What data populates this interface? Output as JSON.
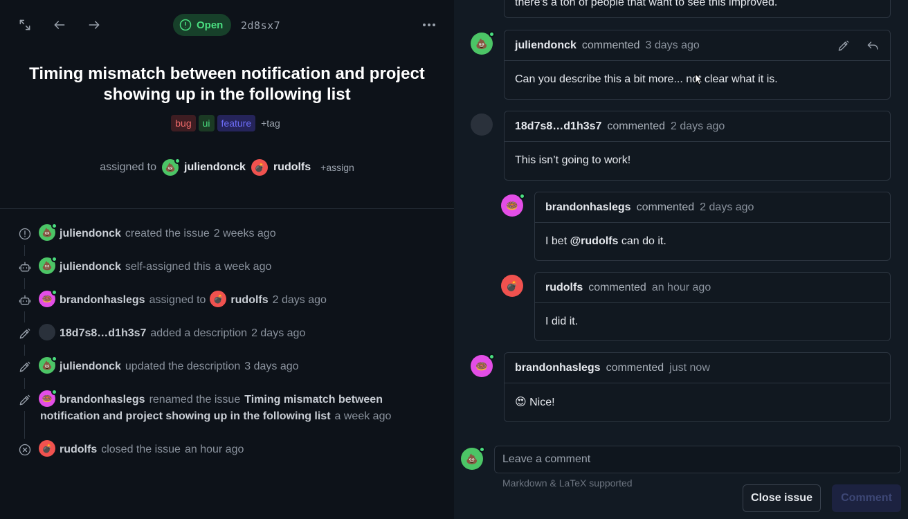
{
  "toolbar": {
    "status_label": "Open",
    "issue_id": "2d8sx7"
  },
  "issue": {
    "title": "Timing mismatch between notification and project showing up in the following list",
    "tags": [
      "bug",
      "ui",
      "feature"
    ],
    "add_tag_label": "+tag",
    "assigned_to_label": "assigned to",
    "assignees": [
      "juliendonck",
      "rudolfs"
    ],
    "add_assign_label": "+assign"
  },
  "timeline": [
    {
      "user": "juliendonck",
      "action": "created the issue",
      "time": "2 weeks ago"
    },
    {
      "user": "juliendonck",
      "action": "self-assigned this",
      "time": "a week ago"
    },
    {
      "user": "brandonhaslegs",
      "action": "assigned to",
      "target": "rudolfs",
      "time": "2 days ago"
    },
    {
      "user": "18d7s8…d1h3s7",
      "action": "added a description",
      "time": "2 days ago"
    },
    {
      "user": "juliendonck",
      "action": "updated the description",
      "time": "3 days ago"
    },
    {
      "user": "brandonhaslegs",
      "action": "renamed the issue",
      "new_title_line1": "Timing mismatch between",
      "new_title_line2": "notification and project showing up in the following list",
      "time": "a week ago"
    },
    {
      "user": "rudolfs",
      "action": "closed the issue",
      "time": "an hour ago"
    }
  ],
  "comments": {
    "partial_text": "there's a ton of people that want to see this improved.",
    "items": [
      {
        "user": "juliendonck",
        "verb": "commented",
        "time": "3 days ago",
        "body": "Can you describe this a bit more... not clear what it is."
      },
      {
        "user": "18d7s8…d1h3s7",
        "verb": "commented",
        "time": "2 days ago",
        "body": "This isn’t going to work!"
      },
      {
        "user": "brandonhaslegs",
        "verb": "commented",
        "time": "2 days ago",
        "body_prefix": "I bet ",
        "mention": "@rudolfs",
        "body_suffix": " can do it."
      },
      {
        "user": "rudolfs",
        "verb": "commented",
        "time": "an hour ago",
        "body": "I did it."
      },
      {
        "user": "brandonhaslegs",
        "verb": "commented",
        "time": "just now",
        "body": "😍 Nice!"
      }
    ]
  },
  "composer": {
    "placeholder": "Leave a comment",
    "hint": "Markdown & LaTeX supported",
    "close_label": "Close issue",
    "comment_label": "Comment"
  },
  "colors": {
    "open_green": "#4ade80",
    "avatar_green": "#4cc566",
    "avatar_pink": "#e34ee6",
    "avatar_red": "#f0524f",
    "tag_bug": "#ef6a6a",
    "tag_feature": "#6c6cf6"
  },
  "icons": [
    "expand-icon",
    "arrow-left-icon",
    "arrow-right-icon",
    "status-open-icon",
    "more-icon",
    "pen-icon",
    "reply-icon",
    "issue-closed-icon",
    "robot-icon"
  ]
}
